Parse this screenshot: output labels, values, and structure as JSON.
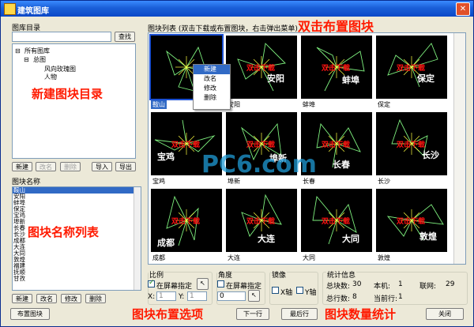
{
  "window": {
    "title": "建筑图库",
    "close_glyph": "✕"
  },
  "library": {
    "label": "图库目录",
    "search_button": "查找",
    "tree": [
      "所有图库",
      "总图",
      "风向玫瑰图",
      "人物"
    ],
    "buttons": [
      "新建",
      "改名",
      "删除",
      "导入",
      "导出"
    ]
  },
  "names": {
    "label": "图块名称",
    "items": [
      "鞍山",
      "安阳",
      "蚌埠",
      "保定",
      "宝鸡",
      "埠新",
      "长春",
      "长沙",
      "成都",
      "大连",
      "大同",
      "敦煌",
      "福建",
      "抚顺",
      "甘孜"
    ],
    "buttons": [
      "新建",
      "改名",
      "修改",
      "删除"
    ]
  },
  "blocks": {
    "label": "图块列表 (双击下载或布置图块，右击弹出菜单)",
    "watermark": "双击下载",
    "items": [
      {
        "name": "鞍山",
        "overlay": ""
      },
      {
        "name": "安阳",
        "overlay": "安阳"
      },
      {
        "name": "蚌埠",
        "overlay": "蚌埠"
      },
      {
        "name": "保定",
        "overlay": "保定"
      },
      {
        "name": "宝鸡",
        "overlay": "宝鸡"
      },
      {
        "name": "埠新",
        "overlay": "埠新"
      },
      {
        "name": "长春",
        "overlay": "长春"
      },
      {
        "name": "长沙",
        "overlay": "长沙"
      },
      {
        "name": "成都",
        "overlay": "成都"
      },
      {
        "name": "大连",
        "overlay": "大连"
      },
      {
        "name": "大同",
        "overlay": "大同"
      },
      {
        "name": "敦煌",
        "overlay": "敦煌"
      }
    ]
  },
  "context_menu": [
    "新建",
    "改名",
    "修改",
    "删除"
  ],
  "scale": {
    "label": "比例",
    "check": "在屏幕指定",
    "x_label": "X:",
    "x": "1",
    "y_label": "Y:",
    "y": "1"
  },
  "angle": {
    "label": "角度",
    "check": "在屏幕指定",
    "value": "0"
  },
  "mirror": {
    "label": "镜像",
    "x_axis": "X轴",
    "y_axis": "Y轴"
  },
  "stats": {
    "label": "统计信息",
    "total_blocks_label": "总块数:",
    "total_blocks": "30",
    "this_machine_label": "本机:",
    "this_machine": "1",
    "network_label": "联网:",
    "network": "29",
    "total_rows_label": "总行数:",
    "total_rows": "8",
    "current_row_label": "当前行:",
    "current_row": "1"
  },
  "footer": {
    "place": "布置图块",
    "next": "下一行",
    "last": "最后行",
    "close": "关闭"
  },
  "annotations": {
    "double_click": "双击布置图块",
    "new_dir": "新建图块目录",
    "name_list": "图块名称列表",
    "options": "图块布置选项",
    "count": "图块数量统计"
  },
  "watermark_logo": "PC6.com",
  "colors": {
    "accent": "#ff1a00",
    "title_bar": "#1a5fd8",
    "selection": "#316ac5"
  }
}
